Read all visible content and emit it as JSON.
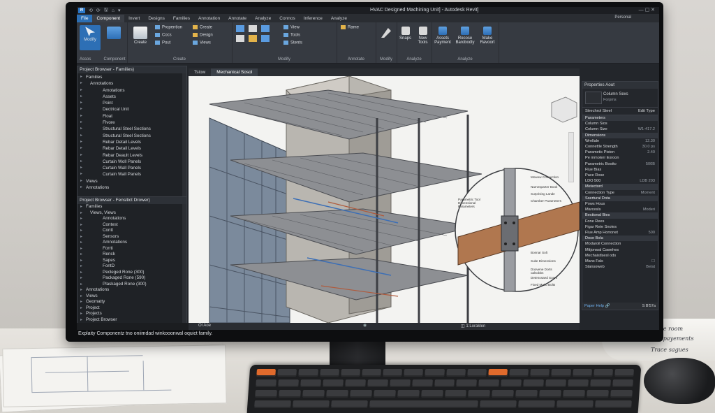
{
  "app": {
    "title": "HVAC Designed Machining Unit] - Autodesk Revit]",
    "user": "Personal"
  },
  "quick_access": [
    "⟲",
    "⟳",
    "🖫",
    "⌂",
    "▾"
  ],
  "ribbon_tabs": [
    "File",
    "Component",
    "Invert",
    "Designs",
    "Families",
    "Annotation",
    "Annotate",
    "Analyze",
    "Connos",
    "Inference",
    "Analyze"
  ],
  "ribbon": {
    "modify_label": "Modify",
    "assets_label": "Assos",
    "component_label": "Component",
    "create_group": {
      "label": "Create",
      "big": "Create",
      "items": [
        "Propention",
        "Cocs",
        "Pout",
        "Create",
        "Design",
        "Views"
      ]
    },
    "modify_group": {
      "label": "Modify",
      "items": [
        "View",
        "Tools",
        "Stents"
      ]
    },
    "annotate_group": {
      "label": "Annotate",
      "item": "Rame"
    },
    "modify2_label": "Modify",
    "analyze_group": {
      "label": "Analyze",
      "items": [
        "Snaps",
        "New Tools"
      ]
    },
    "analyze2_group": {
      "label": "Analyze",
      "items": [
        "Assets Payment",
        "Rocose Barobodly",
        "Make Ravoort"
      ]
    }
  },
  "project_browser_1": {
    "title": "Project Browser - Families)",
    "items": [
      "Families",
      "Annotations",
      "Amotations",
      "Assets",
      "Point",
      "Dectrical Unit",
      "Float",
      "Flvore",
      "Structural Steel Sections",
      "Structural Steel Sections",
      "Rebar Detail Levels",
      "Rebar Detail Levels",
      "Rebar Deault Levels",
      "Curtain Woll Panels",
      "Curtain Wall Panels",
      "Curtain Wall Panels",
      "Views",
      "Annotations"
    ]
  },
  "project_browser_2": {
    "title": "Project Browser - Fensitict Drower)",
    "items": [
      "Families",
      "Views, Views",
      "Annotations",
      "Contest",
      "Contt",
      "Sensors",
      "Amnotations",
      "Forrti",
      "Renck",
      "Sapes",
      "FontD",
      "Pecleged Rone (300)",
      "Packaged Rone (590)",
      "Plaskaged Rone (300)",
      "Annotations",
      "Views",
      "Geomatty",
      "Project",
      "Projects",
      "Project Browser"
    ]
  },
  "status_bar": "Explaity Componentz tno oniimdad winkooonwal oquict family.",
  "view_tabs": [
    "Tslow",
    "Mechanical Sosol"
  ],
  "viewport_status": [
    "Ol Aoe",
    "◫ 1:Loraklen"
  ],
  "detail_callouts": [
    "Parametric Tool Dimensional Parameters",
    "Mowew Connection",
    "Namesparter Book",
    "Surprising Lande",
    "Chamber Parameters",
    "Bonnar Solt",
    "Suite Dimensions",
    "Doovene Dorts oalsobbs",
    "Detenosaed Soars",
    "Fixed Maito Bolts"
  ],
  "properties": {
    "title": "Properties Aout",
    "type_name": "Column Sexs",
    "type_sub": "Forpms",
    "selector": "Strechrol Steel",
    "edit_type": "Edit Type",
    "rows": [
      {
        "k": "Parameters",
        "v": "",
        "sec": true
      },
      {
        "k": "Column Sios",
        "v": ""
      },
      {
        "k": "Column Size",
        "v": "W1-417.2"
      },
      {
        "k": "Dimensions",
        "v": "",
        "sec": true
      },
      {
        "k": "Wrellale",
        "v": "12.30"
      },
      {
        "k": "Connettle Strength",
        "v": "30.0 ps"
      },
      {
        "k": "Parametic Pisten",
        "v": "2.40"
      },
      {
        "k": "Pe mmoterr Exroon",
        "v": ""
      },
      {
        "k": "Parametric Bootto",
        "v": "500B"
      },
      {
        "k": "Flue Bias",
        "v": ""
      },
      {
        "k": "Pace Rose",
        "v": ""
      },
      {
        "k": "LDO 500",
        "v": "LDB 203"
      },
      {
        "k": "Metectord",
        "v": "",
        "sec": true
      },
      {
        "k": "Connection Type",
        "v": "Moment"
      },
      {
        "k": "Ssertural Dota",
        "v": "",
        "sec": true
      },
      {
        "k": "Pows Hous",
        "v": ""
      },
      {
        "k": "Marcesls",
        "v": "Moderi"
      },
      {
        "k": "Bectional Bies",
        "v": "",
        "sec": true
      },
      {
        "k": "Fone Rees",
        "v": ""
      },
      {
        "k": "Figar Rete Snotes",
        "v": ""
      },
      {
        "k": "Flue Amp Horronet",
        "v": "500"
      },
      {
        "k": "Dose Bola",
        "v": "",
        "sec": true
      },
      {
        "k": "Modaroil Connection",
        "v": ""
      },
      {
        "k": "Mitjonwal Cawehes",
        "v": ""
      },
      {
        "k": "Mechaistlsesl ods",
        "v": ""
      },
      {
        "k": "Mans Fals",
        "v": "☐"
      },
      {
        "k": "Stansoweb",
        "v": "Belat"
      }
    ],
    "footer_left": "Paper Help 🔗",
    "footer_right": "S B'57a"
  },
  "desk_notes": [
    "Tarce room",
    "Trace payements",
    "Trace sagues"
  ]
}
